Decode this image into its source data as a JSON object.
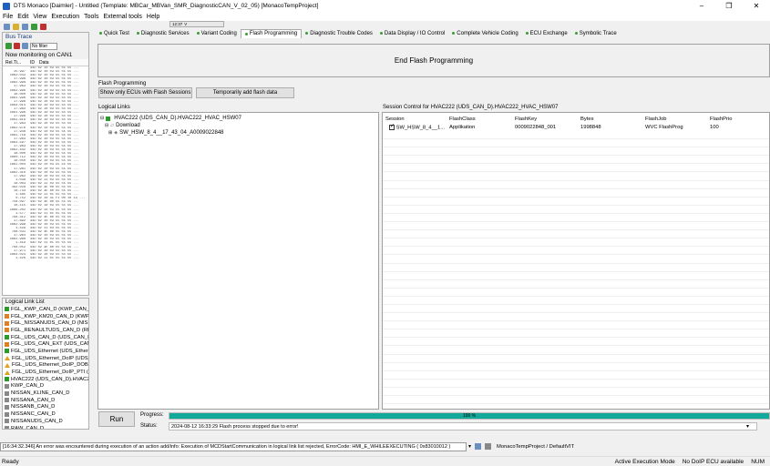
{
  "window": {
    "title": "DTS Monaco [Daimler] - Untitled (Template: MBCar_MBVan_SMR_DiagnosticCAN_V_02_05) [MonacoTempProject]",
    "minimize": "–",
    "maximize": "❐",
    "close": "✕"
  },
  "menu": [
    "File",
    "Edit",
    "View",
    "Execution",
    "Tools",
    "External tools",
    "Help"
  ],
  "top_status": {
    "time": "12:37",
    "version": "V"
  },
  "bus_trace": {
    "title": "Bus Trace",
    "filter": "No filter",
    "monitoring": "Now monitoring on CAN1",
    "columns": [
      "Rel.Ti...",
      "ID",
      "Data"
    ],
    "rows": [
      [
        "",
        "44D 02 10 03 55 55 55 ..."
      ],
      [
        "15.997",
        "44D 02 10 03 55 55 55 ..."
      ],
      [
        "1663.033",
        "44D 02 10 03 55 55 55 ..."
      ],
      [
        "17.996",
        "44D 02 10 03 55 55 55 ..."
      ],
      [
        "1682.996",
        "44D 02 10 03 55 55 55 ..."
      ],
      [
        "17.963",
        "44D 02 10 03 55 55 55 ..."
      ],
      [
        "1662.996",
        "44D 02 10 03 55 55 55 ..."
      ],
      [
        "18.000",
        "44D 02 10 03 55 55 55 ..."
      ],
      [
        "1661.996",
        "44D 02 10 03 55 55 55 ..."
      ],
      [
        "17.998",
        "44D 02 10 03 55 55 55 ..."
      ],
      [
        "1664.014",
        "44D 02 10 03 55 55 55 ..."
      ],
      [
        "17.983",
        "44D 02 10 03 55 55 55 ..."
      ],
      [
        "1661.996",
        "44D 02 10 03 55 55 55 ..."
      ],
      [
        "17.998",
        "44D 02 10 03 55 55 55 ..."
      ],
      [
        "1662.619",
        "44D 02 10 03 55 55 55 ..."
      ],
      [
        "17.983",
        "44D 02 10 03 55 55 55 ..."
      ],
      [
        "1662.976",
        "44D 02 10 03 55 55 55 ..."
      ],
      [
        "17.948",
        "44D 02 10 03 55 55 55 ..."
      ],
      [
        "1661.718",
        "44D 02 10 03 55 55 55 ..."
      ],
      [
        "17.983",
        "44D 02 10 03 55 55 55 ..."
      ],
      [
        "1664.597",
        "44D 02 10 03 55 55 55 ..."
      ],
      [
        "17.983",
        "44D 02 10 03 55 55 55 ..."
      ],
      [
        "1662.442",
        "44D 02 10 03 55 55 55 ..."
      ],
      [
        "18.000",
        "44D 02 10 03 55 55 55 ..."
      ],
      [
        "1660.712",
        "44D 02 10 03 55 55 55 ..."
      ],
      [
        "18.050",
        "44D 02 10 03 55 55 55 ..."
      ],
      [
        "1661.004",
        "44D 02 10 03 55 55 55 ..."
      ],
      [
        "17.981",
        "44D 02 10 03 55 55 55 ..."
      ],
      [
        "1662.310",
        "44D 02 10 03 55 55 55 ..."
      ],
      [
        "17.962",
        "44D 02 10 03 55 55 55 ..."
      ],
      [
        "1.038",
        "44D 02 11 03 55 55 55 ..."
      ],
      [
        "18.003",
        "44D 02 11 03 55 55 55 ..."
      ],
      [
        "162.028",
        "44D 02 3E 00 55 55 55 ..."
      ],
      [
        "18.733",
        "44D 02 3E 80 55 55 55 ..."
      ],
      [
        "1.485",
        "44D 02 11 01 55 55 55 ..."
      ],
      [
        "0.752",
        "44D 02 10 41 F1 00 10 13 ..."
      ],
      [
        "758.097",
        "44D 02 3E 80 55 55 55 ..."
      ],
      [
        "18.115",
        "44D 02 10 03 55 55 55 ..."
      ],
      [
        "1666.202",
        "44D 02 10 03 55 55 55 ..."
      ],
      [
        "1.577",
        "44D 02 11 01 55 55 55 ..."
      ],
      [
        "768.312",
        "44D 02 3E 80 55 55 55 ..."
      ],
      [
        "17.892",
        "44D 02 10 03 55 55 55 ..."
      ],
      [
        "1662.998",
        "44D 02 10 03 55 55 55 ..."
      ],
      [
        "1.429",
        "44D 02 11 03 55 55 55 ..."
      ],
      [
        "768.031",
        "44D 02 3E 80 55 55 55 ..."
      ],
      [
        "17.964",
        "44D 02 10 03 55 55 55 ..."
      ],
      [
        "1662.998",
        "44D 02 10 03 55 55 55 ..."
      ],
      [
        "1.419",
        "44D 02 11 01 55 55 55 ..."
      ],
      [
        "768.052",
        "44D 02 3E 80 55 55 55 ..."
      ],
      [
        "17.971",
        "44D 02 10 03 55 55 55 ..."
      ],
      [
        "1664.024",
        "44D 02 10 03 55 55 55 ..."
      ],
      [
        "1.426",
        "44D 02 11 01 55 55 55 ..."
      ]
    ]
  },
  "logical_link_list": {
    "title": "Logical Link List",
    "items": [
      {
        "label": "FGL_KWP_CAN_D (KWP_CAN_D",
        "icon": "green"
      },
      {
        "label": "FGL_KWP_KM20_CAN_D (KWP",
        "icon": "orange"
      },
      {
        "label": "FGL_NISSANUDS_CAN_D (NISS",
        "icon": "orange"
      },
      {
        "label": "FGL_RENAULTUDS_CAN_D (REN",
        "icon": "orange"
      },
      {
        "label": "FGL_UDS_CAN_D (UDS_CAN_D",
        "icon": "green"
      },
      {
        "label": "FGL_UDS_CAN_EXT (UDS_CAN",
        "icon": "orange"
      },
      {
        "label": "FGL_UDS_Ethernet (UDS_Etherne",
        "icon": "green"
      },
      {
        "label": "FGL_UDS_Ethernet_DoIP (UDS_E",
        "icon": "warn"
      },
      {
        "label": "FGL_UDS_Ethernet_DoIP_DOBT (",
        "icon": "warn"
      },
      {
        "label": "FGL_UDS_Ethernet_DoIP_PTI (U",
        "icon": "warn"
      },
      {
        "label": "HVAC222 (UDS_CAN_D).HVAC2",
        "icon": "green"
      },
      {
        "label": "KWP_CAN_D",
        "icon": "grey"
      },
      {
        "label": "NISSAN_KLINE_CAN_D",
        "icon": "grey"
      },
      {
        "label": "NISSANA_CAN_D",
        "icon": "grey"
      },
      {
        "label": "NISSANB_CAN_D",
        "icon": "grey"
      },
      {
        "label": "NISSANC_CAN_D",
        "icon": "grey"
      },
      {
        "label": "NISSANUDS_CAN_D",
        "icon": "grey"
      },
      {
        "label": "RAW_CAN_D",
        "icon": "grey"
      },
      {
        "label": "RENAULTA_CAN_D",
        "icon": "grey"
      }
    ]
  },
  "tabs": [
    {
      "label": "Quick Test",
      "active": false
    },
    {
      "label": "Diagnostic Services",
      "active": false
    },
    {
      "label": "Variant Coding",
      "active": false
    },
    {
      "label": "Flash Programming",
      "active": true
    },
    {
      "label": "Diagnostic Trouble Codes",
      "active": false
    },
    {
      "label": "Data Display / IO Control",
      "active": false
    },
    {
      "label": "Complete Vehicle Coding",
      "active": false
    },
    {
      "label": "ECU Exchange",
      "active": false
    },
    {
      "label": "Symbolic Trace",
      "active": false
    }
  ],
  "flash": {
    "end_button": "End Flash Programming",
    "section_label": "Flash Programming",
    "show_only_button": "Show only ECUs with Flash Sessions",
    "temp_add_button": "Temporarily add flash data",
    "logical_links_label": "Logical Links",
    "tree": {
      "root": "HVAC222 (UDS_CAN_D).HVAC222_HVAC_HSW07",
      "child": "Download",
      "leaf": "SW_HSW_8_4__17_43_04_A0009022848"
    },
    "session_control_label": "Session Control for HVAC222 (UDS_CAN_D).HVAC222_HVAC_HSW07",
    "session_columns": [
      "Session",
      "FlashClass",
      "FlashKey",
      "Bytes",
      "FlashJob",
      "FlashPrio"
    ],
    "session_row": [
      "SW_HSW_8_4__1...",
      "Applikation",
      "0009022848_001",
      "1998848",
      "WVC FlashProg",
      "100"
    ]
  },
  "run": {
    "run_button": "Run",
    "progress_label": "Progress:",
    "progress_value": 1.0,
    "progress_text": "100 %",
    "status_label": "Status:",
    "status_text": "2024-08-12 16:33:29  Flash process stopped due to error!",
    "dropdown": "▾"
  },
  "message": {
    "text": "[16:34:32.346]  An error was encountered during execution of an action add/info:    Execution of MCDStartCommunication in logical link list rejected, ErrorCode: HMI_E_WHILEEXECUTING   ( 0x83010012 )",
    "dropdown": "▾",
    "project": "MonacoTempProject / DefaultVIT"
  },
  "statusbar": {
    "ready": "Ready",
    "mode": "Active Execution Mode",
    "doip": "No DoIP ECU available",
    "num": "NUM"
  },
  "colors": {
    "progress": "#12a99a",
    "accent": "#1f5fbf"
  }
}
